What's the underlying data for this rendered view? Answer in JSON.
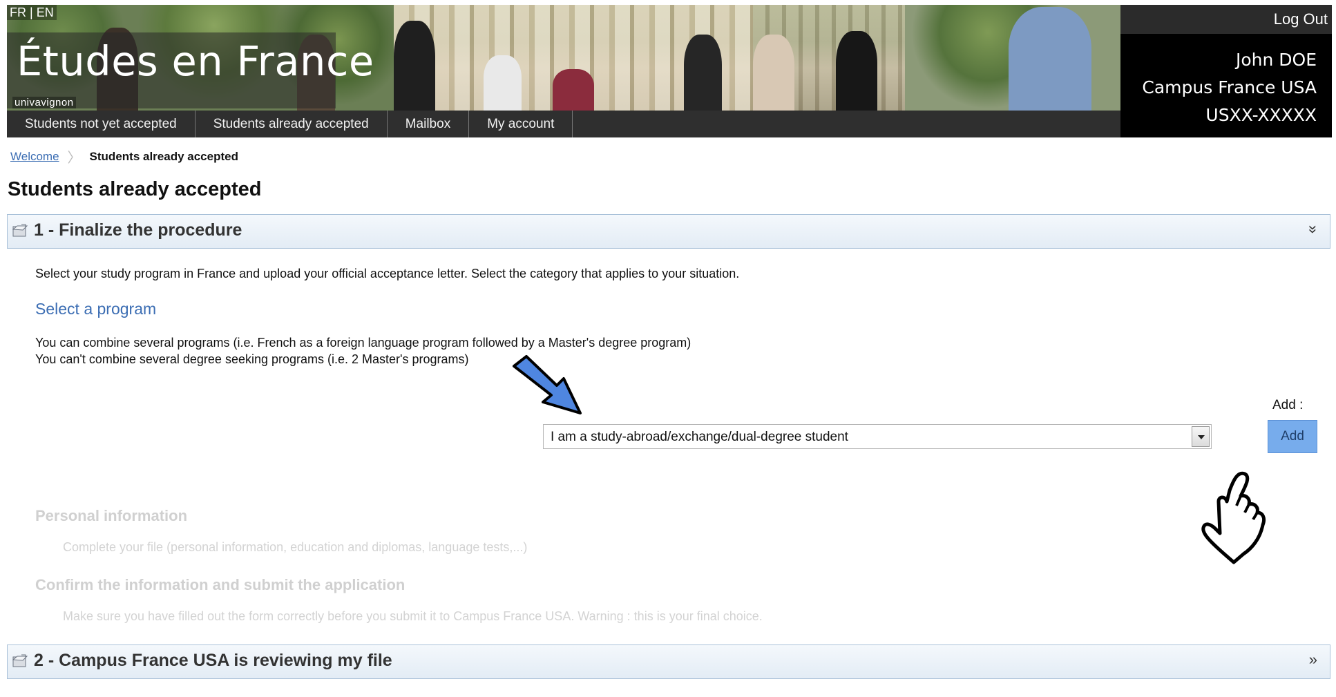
{
  "lang": {
    "fr": "FR",
    "separator": "|",
    "en": "EN"
  },
  "site": {
    "title": "Études en France",
    "partner_logo": "univavignon"
  },
  "user": {
    "logout": "Log Out",
    "name": "John DOE",
    "office": "Campus France USA",
    "id": "USXX-XXXXX"
  },
  "nav": {
    "items": [
      "Students not yet accepted",
      "Students already accepted",
      "Mailbox",
      "My account"
    ]
  },
  "breadcrumb": {
    "home": "Welcome",
    "current": "Students already accepted"
  },
  "page": {
    "title": "Students already accepted"
  },
  "panel1": {
    "title": "1 - Finalize the procedure",
    "toggle_icon": "double-chevron-down-icon",
    "intro": "Select your study program in France and upload your official acceptance letter. Select the category that applies to your situation.",
    "program_heading": "Select a program",
    "combine_1": "You can combine several programs (i.e. French as a foreign language program followed by a Master's degree program)",
    "combine_2": "You can't combine several degree seeking programs (i.e. 2 Master's programs)",
    "add_caption": "Add :",
    "select_value": "I am a study-abroad/exchange/dual-degree student",
    "add_button": "Add",
    "personal_head": "Personal information",
    "personal_text": "Complete your file (personal information, education and diplomas, language tests,...)",
    "confirm_head": "Confirm the information and submit the application",
    "confirm_text": "Make sure you have filled out the form correctly before you submit it to Campus France USA. Warning : this is your final choice."
  },
  "panel2": {
    "title": "2 - Campus France USA is reviewing my file",
    "toggle_icon": "double-chevron-right-icon"
  },
  "colors": {
    "accent_blue": "#3b6db3",
    "button_blue": "#77acec",
    "nav_bg": "#2f2f2f",
    "panel_border": "#a8c0d8"
  }
}
